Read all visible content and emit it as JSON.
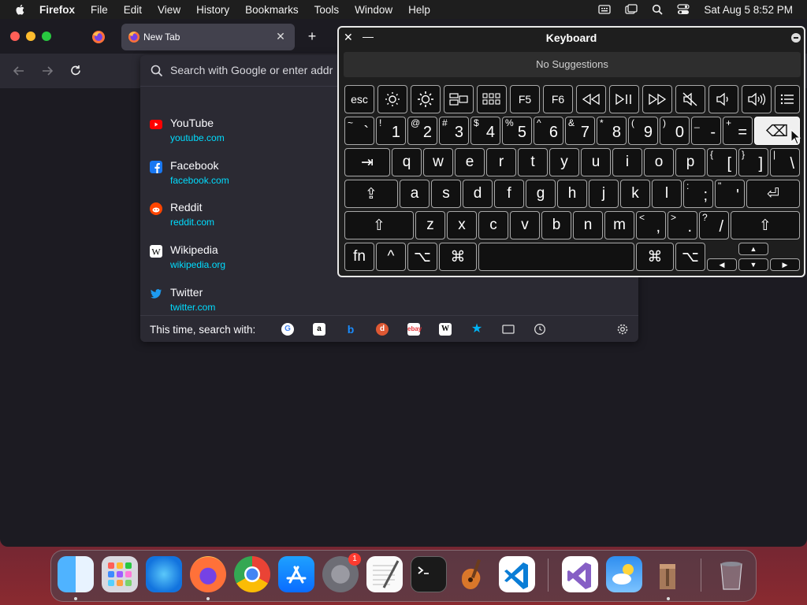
{
  "menubar": {
    "app": "Firefox",
    "menus": [
      "File",
      "Edit",
      "View",
      "History",
      "Bookmarks",
      "Tools",
      "Window",
      "Help"
    ],
    "datetime": "Sat Aug 5  8:52 PM"
  },
  "browser": {
    "tab_title": "New Tab",
    "new_tab_symbol": "+",
    "url_placeholder": "Search with Google or enter addr",
    "suggestions": [
      {
        "name": "YouTube",
        "url": "youtube.com",
        "color": "#ff0000"
      },
      {
        "name": "Facebook",
        "url": "facebook.com",
        "color": "#1877f2"
      },
      {
        "name": "Reddit",
        "url": "reddit.com",
        "color": "#ff4500"
      },
      {
        "name": "Wikipedia",
        "url": "wikipedia.org",
        "color": "#ffffff"
      },
      {
        "name": "Twitter",
        "url": "twitter.com",
        "color": "#1d9bf0"
      }
    ],
    "search_with_label": "This time, search with:",
    "engines": [
      "google-icon",
      "amazon-icon",
      "bing-icon",
      "duckduckgo-icon",
      "ebay-icon",
      "wikipedia-icon",
      "bookmarks-icon",
      "tabs-icon",
      "history-icon"
    ]
  },
  "keyboard_viewer": {
    "title": "Keyboard",
    "suggestions": "No Suggestions",
    "fn_row": [
      "esc",
      "F5",
      "F6"
    ],
    "num_row": [
      {
        "t": "~",
        "b": "`"
      },
      {
        "t": "!",
        "b": "1"
      },
      {
        "t": "@",
        "b": "2"
      },
      {
        "t": "#",
        "b": "3"
      },
      {
        "t": "$",
        "b": "4"
      },
      {
        "t": "%",
        "b": "5"
      },
      {
        "t": "^",
        "b": "6"
      },
      {
        "t": "&",
        "b": "7"
      },
      {
        "t": "*",
        "b": "8"
      },
      {
        "t": "(",
        "b": "9"
      },
      {
        "t": ")",
        "b": "0"
      },
      {
        "t": "_",
        "b": "-"
      },
      {
        "t": "+",
        "b": "="
      }
    ],
    "row_q": [
      "q",
      "w",
      "e",
      "r",
      "t",
      "y",
      "u",
      "i",
      "o",
      "p"
    ],
    "row_q_extra": [
      {
        "t": "{",
        "b": "["
      },
      {
        "t": "}",
        "b": "]"
      },
      {
        "t": "|",
        "b": "\\"
      }
    ],
    "row_a": [
      "a",
      "s",
      "d",
      "f",
      "g",
      "h",
      "j",
      "k",
      "l"
    ],
    "row_a_extra": [
      {
        "t": ":",
        "b": ";"
      },
      {
        "t": "\"",
        "b": "'"
      }
    ],
    "row_z": [
      "z",
      "x",
      "c",
      "v",
      "b",
      "n",
      "m"
    ],
    "row_z_extra": [
      {
        "t": "<",
        "b": ","
      },
      {
        "t": ">",
        "b": "."
      },
      {
        "t": "?",
        "b": "/"
      }
    ],
    "bottom": {
      "fn": "fn",
      "ctrl": "^",
      "opt": "⌥",
      "cmd": "⌘"
    },
    "symbols": {
      "tab": "⇥",
      "caps": "⇪",
      "return": "⏎",
      "shift": "⇧",
      "delete": "⌫",
      "up": "▲",
      "down": "▼",
      "left": "◀",
      "right": "▶"
    }
  },
  "dock": {
    "apps": [
      "finder",
      "launchpad",
      "safari",
      "firefox",
      "chrome",
      "app-store",
      "system-settings",
      "textedit",
      "terminal",
      "garageband",
      "vscode",
      "visual-studio",
      "weather",
      "archive-utility",
      "trash"
    ],
    "settings_badge": "1"
  }
}
